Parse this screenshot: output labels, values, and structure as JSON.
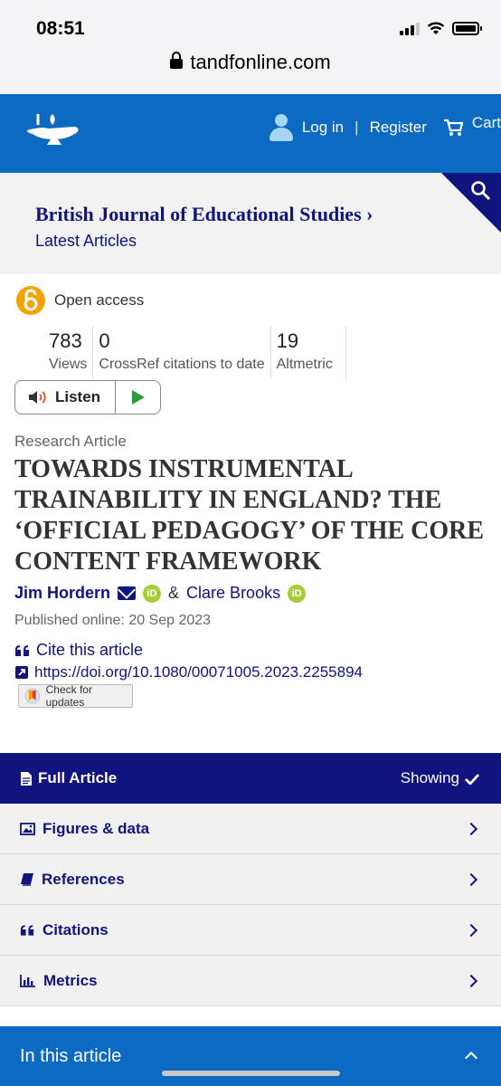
{
  "status": {
    "time": "08:51"
  },
  "browser": {
    "url": "tandfonline.com"
  },
  "header": {
    "login": "Log in",
    "separator": "|",
    "register": "Register",
    "cart": "Cart"
  },
  "journal": {
    "title": "British Journal of Educational Studies",
    "title_suffix": "›",
    "subtitle": "Latest Articles"
  },
  "article": {
    "access": "Open access",
    "metrics": [
      {
        "value": "783",
        "label": "Views"
      },
      {
        "value": "0",
        "label": "CrossRef citations to date"
      },
      {
        "value": "19",
        "label": "Altmetric"
      }
    ],
    "listen_label": "Listen",
    "type": "Research Article",
    "title": "TOWARDS INSTRUMENTAL TRAINABILITY IN ENGLAND? THE ‘OFFICIAL PEDAGOGY’ OF THE CORE CONTENT FRAMEWORK",
    "authors": [
      {
        "name": "Jim Hordern"
      },
      {
        "name": "Clare Brooks"
      }
    ],
    "author_join": "&",
    "published": "Published online: 20 Sep 2023",
    "cite_label": "Cite this article",
    "doi": "https://doi.org/10.1080/00071005.2023.2255894",
    "updates_label": "Check for updates"
  },
  "sections": {
    "full_article": "Full Article",
    "showing": "Showing",
    "items": [
      {
        "label": "Figures & data",
        "icon": "image-icon"
      },
      {
        "label": "References",
        "icon": "book-icon"
      },
      {
        "label": "Citations",
        "icon": "quote-icon"
      },
      {
        "label": "Metrics",
        "icon": "bar-chart-icon"
      }
    ],
    "in_this_article": "In this article"
  },
  "colors": {
    "brand_blue": "#0d6ac2",
    "navy": "#10147e",
    "orcid_green": "#a6ce39",
    "open_access_orange": "#f4a300"
  }
}
